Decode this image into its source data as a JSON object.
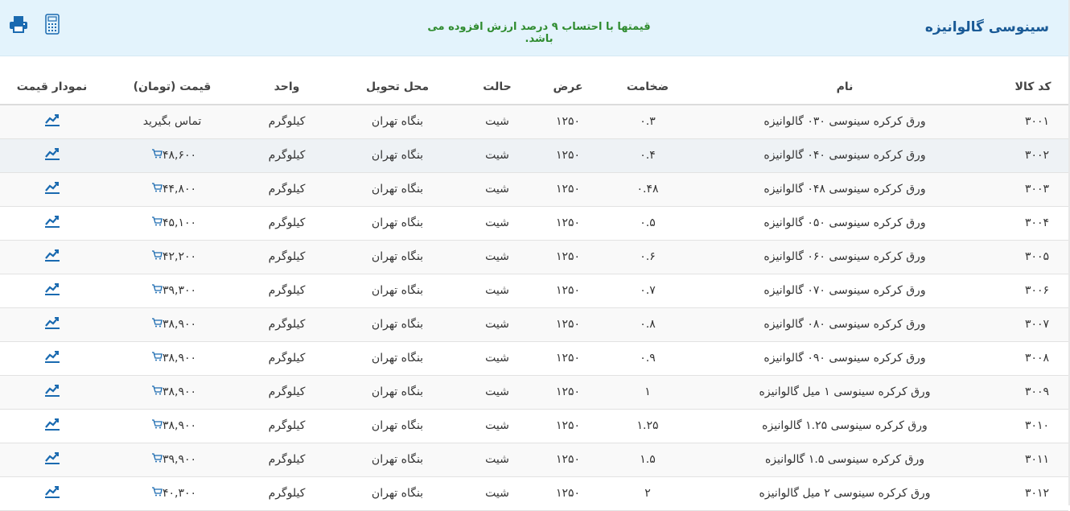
{
  "header": {
    "title": "سینوسی گالوانیزه",
    "note": "قیمتها با احتساب ۹ درصد ارزش افزوده می باشد.",
    "print_icon": "printer-icon",
    "calc_icon": "calculator-icon"
  },
  "table": {
    "columns": {
      "code": "کد کالا",
      "name": "نام",
      "thickness": "ضخامت",
      "width": "عرض",
      "state": "حالت",
      "delivery": "محل تحویل",
      "unit": "واحد",
      "price": "قیمت (تومان)",
      "chart": "نمودار قیمت"
    },
    "rows": [
      {
        "code": "۳۰۰۱",
        "name": "ورق کرکره سینوسی ۰۳۰ گالوانیزه",
        "thickness": "۰.۳",
        "width": "۱۲۵۰",
        "state": "شیت",
        "delivery": "بنگاه تهران",
        "unit": "کیلوگرم",
        "price": "تماس بگیرید",
        "cart": false
      },
      {
        "code": "۳۰۰۲",
        "name": "ورق کرکره سینوسی ۰۴۰ گالوانیزه",
        "thickness": "۰.۴",
        "width": "۱۲۵۰",
        "state": "شیت",
        "delivery": "بنگاه تهران",
        "unit": "کیلوگرم",
        "price": "۴۸,۶۰۰",
        "cart": true
      },
      {
        "code": "۳۰۰۳",
        "name": "ورق کرکره سینوسی ۰۴۸ گالوانیزه",
        "thickness": "۰.۴۸",
        "width": "۱۲۵۰",
        "state": "شیت",
        "delivery": "بنگاه تهران",
        "unit": "کیلوگرم",
        "price": "۴۴,۸۰۰",
        "cart": true
      },
      {
        "code": "۳۰۰۴",
        "name": "ورق کرکره سینوسی ۰۵۰ گالوانیزه",
        "thickness": "۰.۵",
        "width": "۱۲۵۰",
        "state": "شیت",
        "delivery": "بنگاه تهران",
        "unit": "کیلوگرم",
        "price": "۴۵,۱۰۰",
        "cart": true
      },
      {
        "code": "۳۰۰۵",
        "name": "ورق کرکره سینوسی ۰۶۰ گالوانیزه",
        "thickness": "۰.۶",
        "width": "۱۲۵۰",
        "state": "شیت",
        "delivery": "بنگاه تهران",
        "unit": "کیلوگرم",
        "price": "۴۲,۲۰۰",
        "cart": true
      },
      {
        "code": "۳۰۰۶",
        "name": "ورق کرکره سینوسی ۰۷۰ گالوانیزه",
        "thickness": "۰.۷",
        "width": "۱۲۵۰",
        "state": "شیت",
        "delivery": "بنگاه تهران",
        "unit": "کیلوگرم",
        "price": "۳۹,۳۰۰",
        "cart": true
      },
      {
        "code": "۳۰۰۷",
        "name": "ورق کرکره سینوسی ۰۸۰ گالوانیزه",
        "thickness": "۰.۸",
        "width": "۱۲۵۰",
        "state": "شیت",
        "delivery": "بنگاه تهران",
        "unit": "کیلوگرم",
        "price": "۳۸,۹۰۰",
        "cart": true
      },
      {
        "code": "۳۰۰۸",
        "name": "ورق کرکره سینوسی ۰۹۰ گالوانیزه",
        "thickness": "۰.۹",
        "width": "۱۲۵۰",
        "state": "شیت",
        "delivery": "بنگاه تهران",
        "unit": "کیلوگرم",
        "price": "۳۸,۹۰۰",
        "cart": true
      },
      {
        "code": "۳۰۰۹",
        "name": "ورق کرکره سینوسی ۱ میل گالوانیزه",
        "thickness": "۱",
        "width": "۱۲۵۰",
        "state": "شیت",
        "delivery": "بنگاه تهران",
        "unit": "کیلوگرم",
        "price": "۳۸,۹۰۰",
        "cart": true
      },
      {
        "code": "۳۰۱۰",
        "name": "ورق کرکره سینوسی ۱.۲۵ گالوانیزه",
        "thickness": "۱.۲۵",
        "width": "۱۲۵۰",
        "state": "شیت",
        "delivery": "بنگاه تهران",
        "unit": "کیلوگرم",
        "price": "۳۸,۹۰۰",
        "cart": true
      },
      {
        "code": "۳۰۱۱",
        "name": "ورق کرکره سینوسی ۱.۵ گالوانیزه",
        "thickness": "۱.۵",
        "width": "۱۲۵۰",
        "state": "شیت",
        "delivery": "بنگاه تهران",
        "unit": "کیلوگرم",
        "price": "۳۹,۹۰۰",
        "cart": true
      },
      {
        "code": "۳۰۱۲",
        "name": "ورق کرکره سینوسی ۲ میل گالوانیزه",
        "thickness": "۲",
        "width": "۱۲۵۰",
        "state": "شیت",
        "delivery": "بنگاه تهران",
        "unit": "کیلوگرم",
        "price": "۴۰,۳۰۰",
        "cart": true
      }
    ]
  },
  "colors": {
    "header_bg": "#e3f3fc",
    "title": "#1a5a96",
    "note": "#2e8b2e",
    "icon": "#1a6ab0"
  }
}
